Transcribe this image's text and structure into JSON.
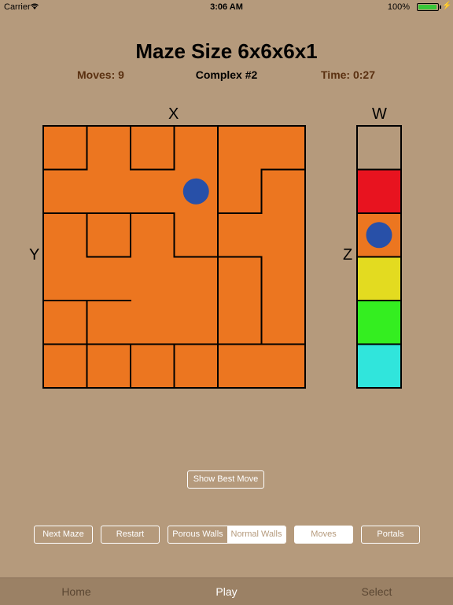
{
  "status": {
    "carrier": "Carrier",
    "time": "3:06 AM",
    "battery": "100%"
  },
  "header": {
    "title": "Maze Size 6x6x6x1",
    "moves": "Moves: 9",
    "puzzle": "Complex #2",
    "timer": "Time: 0:27"
  },
  "axes": {
    "x": "X",
    "y": "Y",
    "z": "Z",
    "w": "W"
  },
  "colors": {
    "background": "#b59a7c",
    "maze_fill": "#ec7620",
    "player": "#2850a8",
    "level_colors": [
      "#b59a7c",
      "#e8131f",
      "#ec7620",
      "#e3db20",
      "#34ee20",
      "#30e5dc"
    ]
  },
  "maze": {
    "size": 6,
    "player_cell": [
      3,
      1
    ],
    "walls_h": [
      [
        0,
        1,
        0,
        1,
        0,
        5,
        1,
        5,
        2,
        4,
        2,
        6
      ],
      [
        1,
        0,
        1,
        2,
        2,
        0,
        2,
        1,
        2,
        2,
        3,
        1
      ],
      [
        3,
        3,
        4,
        1,
        3,
        4,
        4,
        0,
        4,
        1,
        5,
        0
      ],
      [
        5,
        1,
        5,
        2,
        5,
        3,
        5,
        4,
        5,
        5
      ]
    ],
    "walls_v": [
      [
        1,
        0,
        2,
        0,
        3,
        0,
        4,
        0
      ],
      [
        4,
        1,
        5,
        1
      ],
      [
        1,
        2,
        2,
        2,
        3,
        2,
        4,
        2,
        4,
        3,
        5,
        3
      ],
      [
        1,
        4,
        4,
        4,
        5,
        4
      ],
      [
        1,
        5,
        2,
        5,
        3,
        5,
        4,
        5
      ]
    ],
    "outer": true
  },
  "level_column": {
    "levels": 6,
    "player_level": 2
  },
  "controls": {
    "show_best_move": "Show Best Move",
    "next_maze": "Next Maze",
    "restart": "Restart",
    "porous_walls": "Porous Walls",
    "normal_walls": "Normal Walls",
    "moves": "Moves",
    "portals": "Portals"
  },
  "tabs": {
    "home": "Home",
    "play": "Play",
    "select": "Select"
  }
}
